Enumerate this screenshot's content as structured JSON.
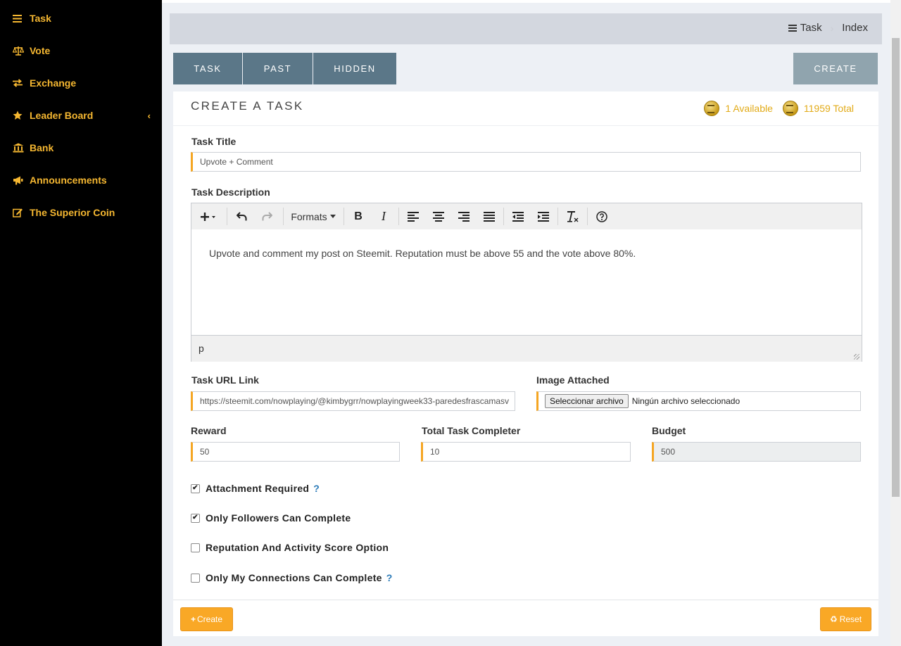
{
  "sidebar": {
    "items": [
      {
        "label": "Task",
        "icon": "menu-icon"
      },
      {
        "label": "Vote",
        "icon": "scale-icon"
      },
      {
        "label": "Exchange",
        "icon": "exchange-icon"
      },
      {
        "label": "Leader Board",
        "icon": "star-icon"
      },
      {
        "label": "Bank",
        "icon": "bank-icon"
      },
      {
        "label": "Announcements",
        "icon": "bullhorn-icon"
      },
      {
        "label": "The Superior Coin",
        "icon": "edit-icon"
      }
    ]
  },
  "breadcrumb": {
    "root": "Task",
    "current": "Index"
  },
  "tabs": [
    {
      "label": "TASK"
    },
    {
      "label": "PAST"
    },
    {
      "label": "HIDDEN"
    }
  ],
  "create_tab_label": "CREATE",
  "card": {
    "title": "CREATE A TASK",
    "available": "1 Available",
    "total": "11959 Total"
  },
  "form": {
    "task_title_label": "Task Title",
    "task_title_value": "Upvote + Comment",
    "description_label": "Task Description",
    "description_text": "Upvote and comment my post on Steemit. Reputation must be above 55 and the vote above 80%.",
    "editor": {
      "formats_label": "Formats",
      "path": "p"
    },
    "url_label": "Task URL Link",
    "url_value": "https://steemit.com/nowplaying/@kimbygrr/nowplayingweek33-paredesfrascamasv",
    "image_label": "Image Attached",
    "file_button": "Seleccionar archivo",
    "file_status": "Ningún archivo seleccionado",
    "reward_label": "Reward",
    "reward_value": "50",
    "completer_label": "Total Task Completer",
    "completer_value": "10",
    "budget_label": "Budget",
    "budget_value": "500",
    "checkboxes": [
      {
        "label": "Attachment Required",
        "checked": true,
        "help": "?"
      },
      {
        "label": "Only Followers Can Complete",
        "checked": true,
        "help": ""
      },
      {
        "label": "Reputation And Activity Score Option",
        "checked": false,
        "help": ""
      },
      {
        "label": "Only My Connections Can Complete",
        "checked": false,
        "help": "?"
      }
    ]
  },
  "buttons": {
    "create": "Create",
    "reset": "Reset"
  },
  "colors": {
    "accent": "#f5b731",
    "tab": "#5b7788",
    "button": "#f9a826"
  }
}
